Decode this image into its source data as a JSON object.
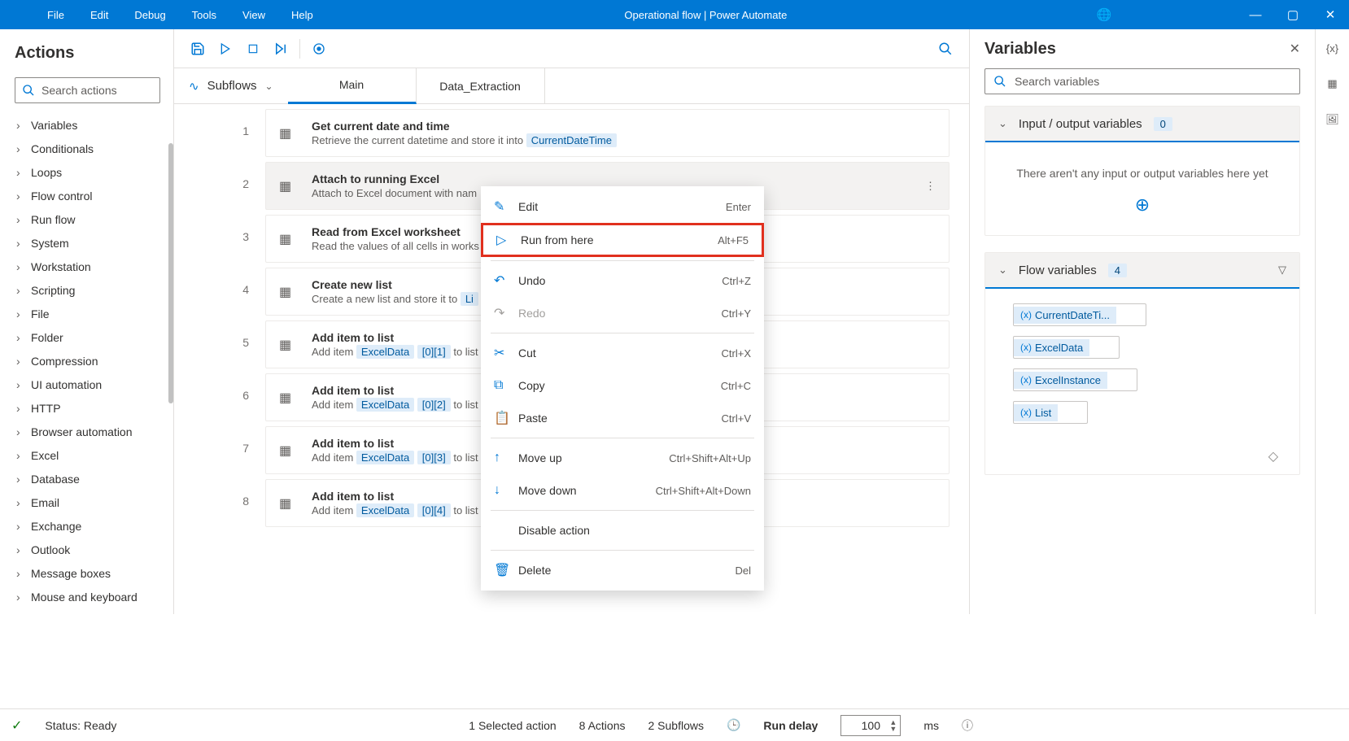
{
  "titlebar": {
    "menus": [
      "File",
      "Edit",
      "Debug",
      "Tools",
      "View",
      "Help"
    ],
    "title": "Operational flow | Power Automate"
  },
  "actions": {
    "title": "Actions",
    "search_placeholder": "Search actions",
    "categories": [
      "Variables",
      "Conditionals",
      "Loops",
      "Flow control",
      "Run flow",
      "System",
      "Workstation",
      "Scripting",
      "File",
      "Folder",
      "Compression",
      "UI automation",
      "HTTP",
      "Browser automation",
      "Excel",
      "Database",
      "Email",
      "Exchange",
      "Outlook",
      "Message boxes",
      "Mouse and keyboard"
    ]
  },
  "subflows": {
    "label": "Subflows",
    "tabs": [
      "Main",
      "Data_Extraction"
    ],
    "active": 0
  },
  "steps": [
    {
      "num": 1,
      "title": "Get current date and time",
      "subPre": "Retrieve the current datetime and store it into ",
      "var": "CurrentDateTime"
    },
    {
      "num": 2,
      "title": "Attach to running Excel",
      "subPre": "Attach to Excel document with nam",
      "selected": true
    },
    {
      "num": 3,
      "title": "Read from Excel worksheet",
      "subPre": "Read the values of all cells in works"
    },
    {
      "num": 4,
      "title": "Create new list",
      "subPre": "Create a new list and store it to  ",
      "var": "Li"
    },
    {
      "num": 5,
      "title": "Add item to list",
      "subPre": "Add item ",
      "var": "ExcelData",
      "idx": "[0][1]",
      "tail": " to list"
    },
    {
      "num": 6,
      "title": "Add item to list",
      "subPre": "Add item ",
      "var": "ExcelData",
      "idx": "[0][2]",
      "tail": " to list"
    },
    {
      "num": 7,
      "title": "Add item to list",
      "subPre": "Add item ",
      "var": "ExcelData",
      "idx": "[0][3]",
      "tail": " to list"
    },
    {
      "num": 8,
      "title": "Add item to list",
      "subPre": "Add item ",
      "var": "ExcelData",
      "idx": "[0][4]",
      "tail": " to list"
    }
  ],
  "context": [
    {
      "icon": "✎",
      "label": "Edit",
      "short": "Enter"
    },
    {
      "icon": "▷",
      "label": "Run from here",
      "short": "Alt+F5",
      "hi": true
    },
    {
      "sep": true
    },
    {
      "icon": "↶",
      "label": "Undo",
      "short": "Ctrl+Z"
    },
    {
      "icon": "↷",
      "label": "Redo",
      "short": "Ctrl+Y",
      "disabled": true
    },
    {
      "sep": true
    },
    {
      "icon": "✂",
      "label": "Cut",
      "short": "Ctrl+X"
    },
    {
      "icon": "⧉",
      "label": "Copy",
      "short": "Ctrl+C"
    },
    {
      "icon": "📋",
      "label": "Paste",
      "short": "Ctrl+V"
    },
    {
      "sep": true
    },
    {
      "icon": "↑",
      "label": "Move up",
      "short": "Ctrl+Shift+Alt+Up"
    },
    {
      "icon": "↓",
      "label": "Move down",
      "short": "Ctrl+Shift+Alt+Down"
    },
    {
      "sep": true
    },
    {
      "icon": "",
      "label": "Disable action",
      "short": ""
    },
    {
      "sep": true
    },
    {
      "icon": "🗑",
      "label": "Delete",
      "short": "Del"
    }
  ],
  "variables": {
    "title": "Variables",
    "search_placeholder": "Search variables",
    "io": {
      "title": "Input / output variables",
      "count": "0",
      "empty": "There aren't any input or output variables here yet"
    },
    "flow": {
      "title": "Flow variables",
      "count": "4",
      "items": [
        "CurrentDateTi...",
        "ExcelData",
        "ExcelInstance",
        "List"
      ]
    }
  },
  "status": {
    "label": "Status:",
    "value": "Ready",
    "selected": "1 Selected action",
    "actions": "8 Actions",
    "subflows": "2 Subflows",
    "run_delay_label": "Run delay",
    "run_delay_value": "100",
    "ms": "ms"
  }
}
